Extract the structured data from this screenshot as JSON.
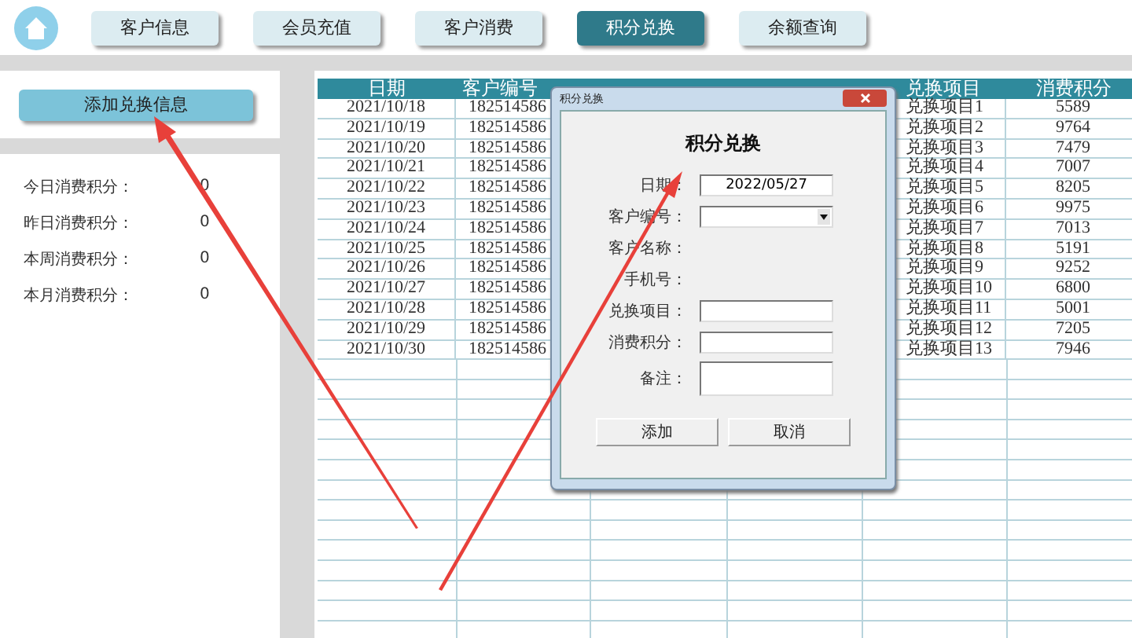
{
  "nav": {
    "tabs": [
      {
        "label": "客户信息",
        "selected": false
      },
      {
        "label": "会员充值",
        "selected": false
      },
      {
        "label": "客户消费",
        "selected": false
      },
      {
        "label": "积分兑换",
        "selected": true
      },
      {
        "label": "余额查询",
        "selected": false
      }
    ]
  },
  "sidebar": {
    "action": "添加兑换信息",
    "stats": [
      {
        "label": "今日消费积分：",
        "value": "0"
      },
      {
        "label": "昨日消费积分：",
        "value": "0"
      },
      {
        "label": "本周消费积分：",
        "value": "0"
      },
      {
        "label": "本月消费积分：",
        "value": "0"
      }
    ]
  },
  "table": {
    "columns": [
      "日期",
      "客户编号",
      "兑换项目",
      "消费积分"
    ],
    "rows": [
      {
        "date": "2021/10/18",
        "customer_no": "182514586",
        "item": "兑换项目1",
        "points": "5589"
      },
      {
        "date": "2021/10/19",
        "customer_no": "182514586",
        "item": "兑换项目2",
        "points": "9764"
      },
      {
        "date": "2021/10/20",
        "customer_no": "182514586",
        "item": "兑换项目3",
        "points": "7479"
      },
      {
        "date": "2021/10/21",
        "customer_no": "182514586",
        "item": "兑换项目4",
        "points": "7007"
      },
      {
        "date": "2021/10/22",
        "customer_no": "182514586",
        "item": "兑换项目5",
        "points": "8205"
      },
      {
        "date": "2021/10/23",
        "customer_no": "182514586",
        "item": "兑换项目6",
        "points": "9975"
      },
      {
        "date": "2021/10/24",
        "customer_no": "182514586",
        "item": "兑换项目7",
        "points": "7013"
      },
      {
        "date": "2021/10/25",
        "customer_no": "182514586",
        "item": "兑换项目8",
        "points": "5191"
      },
      {
        "date": "2021/10/26",
        "customer_no": "182514586",
        "item": "兑换项目9",
        "points": "9252"
      },
      {
        "date": "2021/10/27",
        "customer_no": "182514586",
        "item": "兑换项目10",
        "points": "6800"
      },
      {
        "date": "2021/10/28",
        "customer_no": "182514586",
        "item": "兑换项目11",
        "points": "5001"
      },
      {
        "date": "2021/10/29",
        "customer_no": "182514586",
        "item": "兑换项目12",
        "points": "7205"
      },
      {
        "date": "2021/10/30",
        "customer_no": "182514586",
        "item": "兑换项目13",
        "points": "7946"
      }
    ]
  },
  "dialog": {
    "title": "积分兑换",
    "heading": "积分兑换",
    "fields": [
      {
        "label": "日期：",
        "kind": "text",
        "value": "2022/05/27"
      },
      {
        "label": "客户编号：",
        "kind": "dropdown"
      },
      {
        "label": "客户名称：",
        "kind": "label"
      },
      {
        "label": "手机号：",
        "kind": "label"
      },
      {
        "label": "兑换项目：",
        "kind": "text"
      },
      {
        "label": "消费积分：",
        "kind": "text"
      },
      {
        "label": "备注：",
        "kind": "textarea"
      }
    ],
    "buttons": [
      "添加",
      "取消"
    ]
  }
}
